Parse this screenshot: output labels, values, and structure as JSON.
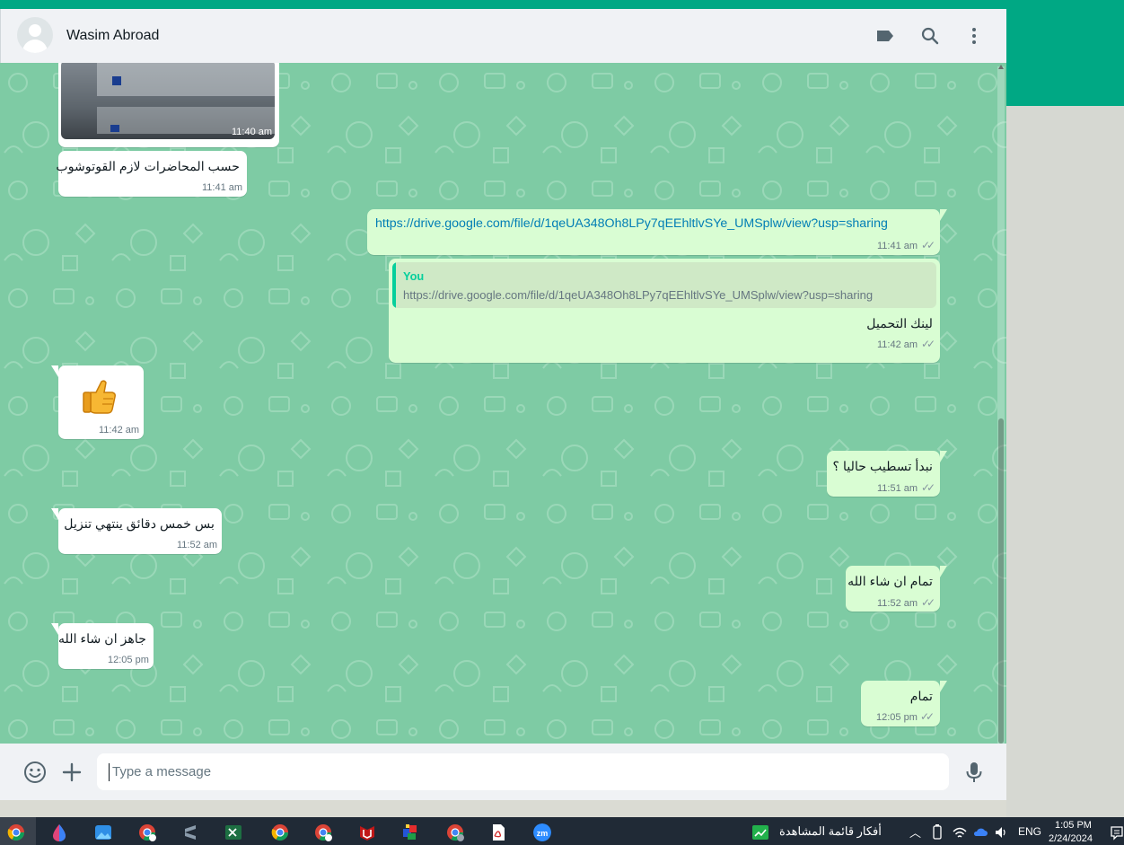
{
  "header": {
    "contact_name": "Wasim Abroad",
    "icons": [
      "label-icon",
      "search-icon",
      "menu-icon"
    ]
  },
  "messages": [
    {
      "direction": "incoming",
      "type": "image",
      "time": "11:40 am"
    },
    {
      "direction": "incoming",
      "type": "text",
      "text": "حسب المحاضرات لازم القوتوشوب",
      "time": "11:41 am"
    },
    {
      "direction": "outgoing",
      "type": "link",
      "text": "https://drive.google.com/file/d/1qeUA348Oh8LPy7qEEhltlvSYe_UMSplw/view?usp=sharing",
      "time": "11:41 am",
      "status": "read"
    },
    {
      "direction": "outgoing",
      "type": "reply",
      "quote_author": "You",
      "quote_text": "https://drive.google.com/file/d/1qeUA348Oh8LPy7qEEhltlvSYe_UMSplw/view?usp=sharing",
      "text": "لينك التحميل",
      "time": "11:42 am",
      "status": "read"
    },
    {
      "direction": "incoming",
      "type": "emoji",
      "emoji": "thumbs-up",
      "time": "11:42 am"
    },
    {
      "direction": "outgoing",
      "type": "text",
      "text": "نبدأ تسطيب حاليا ؟",
      "time": "11:51 am",
      "status": "read"
    },
    {
      "direction": "incoming",
      "type": "text",
      "text": "بس خمس دقائق ينتهي تنزيل",
      "time": "11:52 am"
    },
    {
      "direction": "outgoing",
      "type": "text",
      "text": "تمام ان شاء الله",
      "time": "11:52 am",
      "status": "read"
    },
    {
      "direction": "incoming",
      "type": "text",
      "text": "جاهز ان شاء الله",
      "time": "12:05 pm"
    },
    {
      "direction": "outgoing",
      "type": "text",
      "text": "تمام",
      "time": "12:05 pm",
      "status": "read"
    }
  ],
  "footer": {
    "placeholder": "Type a message"
  },
  "taskbar": {
    "widget_text": "أفكار قائمة المشاهدة",
    "language": "ENG",
    "clock_time": "1:05 PM",
    "clock_date": "2/24/2024",
    "apps": [
      "chrome-icon",
      "paint-icon",
      "photos-icon",
      "chrome-profile-icon",
      "sublime-icon",
      "excel-icon",
      "chrome-icon",
      "chrome-profile-icon",
      "mcafee-icon",
      "app-icon",
      "chrome-profile-icon",
      "pdf-icon",
      "zoom-icon"
    ],
    "zoom_label": "zm"
  },
  "colors": {
    "accent": "#00a884",
    "chat_bg": "#7ecba4",
    "outgoing_bubble": "#d9fdd3",
    "incoming_bubble": "#ffffff",
    "link": "#027eb5"
  }
}
